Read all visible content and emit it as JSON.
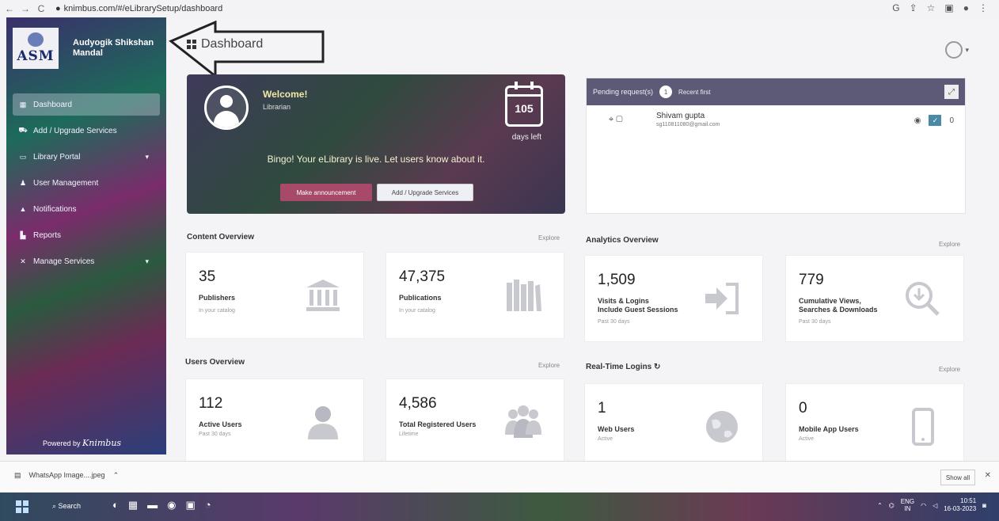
{
  "browser": {
    "url": "knimbus.com/#/eLibrarySetup/dashboard",
    "nav_back": "←",
    "nav_forward": "→",
    "nav_reload": "C"
  },
  "sidebar": {
    "brand_abbr": "ASM",
    "brand_name_line1": "Audyogik Shikshan",
    "brand_name_line2": "Mandal",
    "items": [
      {
        "label": "Dashboard",
        "icon": "dashboard-icon",
        "active": true
      },
      {
        "label": "Add / Upgrade Services",
        "icon": "cart-icon"
      },
      {
        "label": "Library Portal",
        "icon": "monitor-icon",
        "has_submenu": true
      },
      {
        "label": "User Management",
        "icon": "users-icon"
      },
      {
        "label": "Notifications",
        "icon": "bell-icon"
      },
      {
        "label": "Reports",
        "icon": "chart-icon"
      },
      {
        "label": "Manage Services",
        "icon": "tools-icon",
        "has_submenu": true
      }
    ],
    "powered_by": "Powered by",
    "powered_brand": "Knimbus"
  },
  "header": {
    "title": "Dashboard"
  },
  "welcome": {
    "title": "Welcome!",
    "role": "Librarian",
    "days_count": "105",
    "days_label": "days left",
    "message": "Bingo! Your eLibrary is live. Let users know about it.",
    "button1": "Make announcement",
    "button2": "Add / Upgrade Services"
  },
  "pending": {
    "title": "Pending request(s)",
    "count": "1",
    "recent": "Recent first",
    "requests": [
      {
        "name": "Shivam gupta",
        "email": "sg110811080@gmail.com",
        "count": "0"
      }
    ]
  },
  "content_overview": {
    "title": "Content Overview",
    "explore": "Explore",
    "cards": [
      {
        "value": "35",
        "label": "Publishers",
        "sub": "In your catalog",
        "icon": "bank-icon"
      },
      {
        "value": "47,375",
        "label": "Publications",
        "sub": "In your catalog",
        "icon": "books-icon"
      }
    ]
  },
  "analytics_overview": {
    "title": "Analytics Overview",
    "explore": "Explore",
    "cards": [
      {
        "value": "1,509",
        "label_line1": "Visits & Logins",
        "label_line2": "Include Guest Sessions",
        "sub": "Past 30 days",
        "icon": "login-icon"
      },
      {
        "value": "779",
        "label_line1": "Cumulative Views,",
        "label_line2": "Searches & Downloads",
        "sub": "Past 30 days",
        "icon": "download-search-icon"
      }
    ]
  },
  "users_overview": {
    "title": "Users Overview",
    "explore": "Explore",
    "cards": [
      {
        "value": "112",
        "label": "Active Users",
        "sub": "Past 30 days",
        "icon": "user-icon"
      },
      {
        "value": "4,586",
        "label": "Total Registered Users",
        "sub": "Lifetime",
        "icon": "group-icon"
      }
    ]
  },
  "realtime": {
    "title": "Real-Time Logins",
    "explore": "Explore",
    "cards": [
      {
        "value": "1",
        "label": "Web Users",
        "sub": "Active",
        "icon": "globe-icon"
      },
      {
        "value": "0",
        "label": "Mobile App Users",
        "sub": "Active",
        "icon": "mobile-icon"
      }
    ]
  },
  "downloads": {
    "file": "WhatsApp Image....jpeg",
    "show_all": "Show all"
  },
  "taskbar": {
    "search": "Search",
    "lang_line1": "ENG",
    "lang_line2": "IN",
    "time": "10:51",
    "date": "16-03-2023"
  }
}
